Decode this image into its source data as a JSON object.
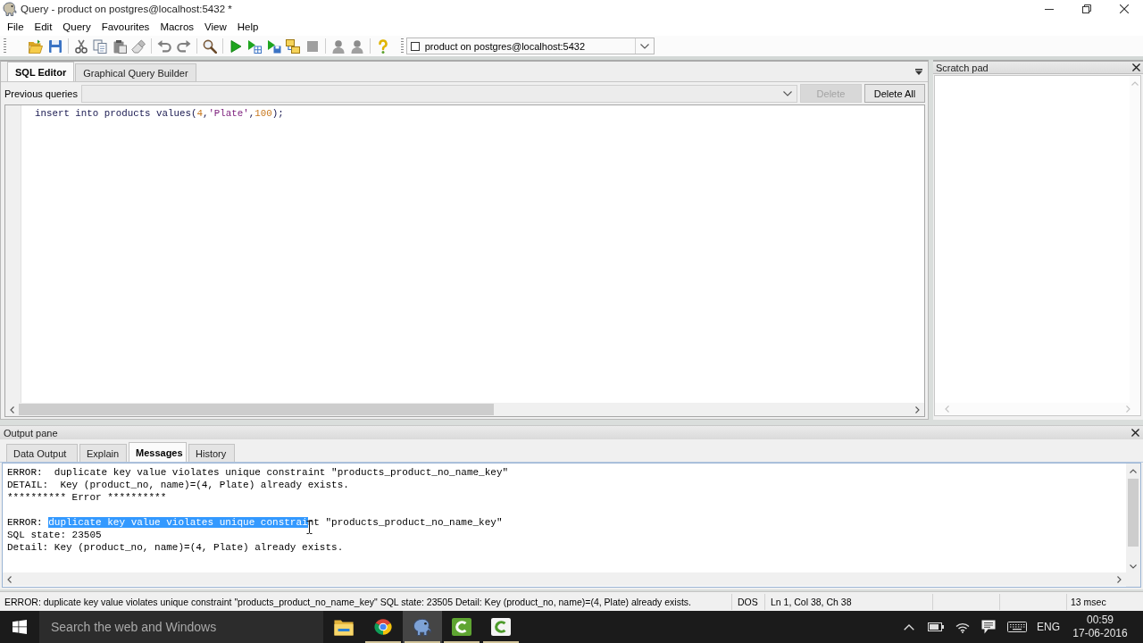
{
  "window": {
    "title": "Query - product on postgres@localhost:5432 *"
  },
  "menu": [
    "File",
    "Edit",
    "Query",
    "Favourites",
    "Macros",
    "View",
    "Help"
  ],
  "toolbar": {
    "connection": "product on postgres@localhost:5432"
  },
  "editor": {
    "tabs": [
      {
        "label": "SQL Editor",
        "selected": true
      },
      {
        "label": "Graphical Query Builder",
        "selected": false
      }
    ],
    "previous_queries_label": "Previous queries",
    "buttons": [
      {
        "label": "Delete",
        "disabled": true
      },
      {
        "label": "Delete All",
        "disabled": false
      }
    ],
    "code_lines": [
      {
        "tokens": [
          {
            "text": "insert into products values(",
            "kind": "plain"
          },
          {
            "text": "4",
            "kind": "number"
          },
          {
            "text": ",",
            "kind": "plain"
          },
          {
            "text": "'Plate'",
            "kind": "string"
          },
          {
            "text": ",",
            "kind": "plain"
          },
          {
            "text": "100",
            "kind": "number"
          },
          {
            "text": ");",
            "kind": "plain"
          }
        ]
      }
    ]
  },
  "scratch_pad": {
    "title": "Scratch pad"
  },
  "output_pane": {
    "title": "Output pane",
    "tabs": [
      {
        "label": "Data Output",
        "selected": false
      },
      {
        "label": "Explain",
        "selected": false
      },
      {
        "label": "Messages",
        "selected": true
      },
      {
        "label": "History",
        "selected": false
      }
    ],
    "messages": [
      {
        "lines": [
          {
            "segments": [
              {
                "text": "ERROR:  duplicate key value violates unique constraint \"products_product_no_name_key\"",
                "selected": false
              }
            ]
          },
          {
            "segments": [
              {
                "text": "DETAIL:  Key (product_no, name)=(4, Plate) already exists.",
                "selected": false
              }
            ]
          },
          {
            "segments": [
              {
                "text": "********** Error **********",
                "selected": false
              }
            ]
          }
        ]
      },
      {
        "lines": [
          {
            "segments": [
              {
                "text": "ERROR: ",
                "selected": false
              },
              {
                "text": "duplicate key value violates unique constrai",
                "selected": true
              },
              {
                "text": "nt \"products_product_no_name_key\"",
                "selected": false
              }
            ]
          },
          {
            "segments": [
              {
                "text": "SQL state: 23505",
                "selected": false
              }
            ]
          },
          {
            "segments": [
              {
                "text": "Detail: Key (product_no, name)=(4, Plate) already exists.",
                "selected": false
              }
            ]
          }
        ]
      }
    ]
  },
  "status_bar": {
    "message": "ERROR: duplicate key value violates unique constraint \"products_product_no_name_key\" SQL state: 23505 Detail: Key (product_no, name)=(4, Plate) already exists.",
    "line_ending": "DOS",
    "position": "Ln 1, Col 38, Ch 38",
    "elapsed": "13 msec"
  },
  "taskbar": {
    "search": {
      "placeholder": "Search the web and Windows"
    },
    "apps": [
      {
        "running": false,
        "active": false
      },
      {
        "running": true,
        "active": false
      },
      {
        "running": true,
        "active": true
      },
      {
        "running": true,
        "active": false
      },
      {
        "running": true,
        "active": false
      }
    ],
    "language": "ENG",
    "time": "00:59",
    "date": "17-06-2016"
  }
}
